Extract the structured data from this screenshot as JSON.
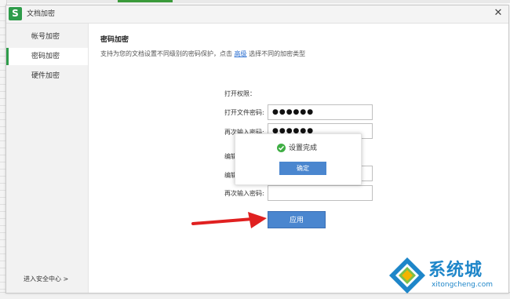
{
  "window": {
    "title": "文档加密"
  },
  "sidebar": {
    "items": [
      {
        "label": "帐号加密"
      },
      {
        "label": "密码加密"
      },
      {
        "label": "硬件加密"
      }
    ],
    "security_center_label": "进入安全中心 >"
  },
  "main": {
    "section_title": "密码加密",
    "description_prefix": "支持为您的文档设置不同级别的密码保护，点击",
    "description_link": "高级",
    "description_suffix": "选择不同的加密类型",
    "open_permission_label": "打开权限：",
    "open_password_label": "打开文件密码:",
    "open_password_value": "●●●●●●",
    "reenter_open_label": "再次输入密码:",
    "reenter_open_value": "●●●●●●",
    "edit_permission_label": "编辑",
    "edit_password_label": "编辑",
    "reenter_edit_label": "再次输入密码:",
    "reenter_edit_value": "",
    "apply_label": "应用"
  },
  "toast": {
    "message": "设置完成",
    "confirm_label": "确定"
  },
  "watermark": {
    "brand_cn": "系统城",
    "brand_en": "xitongcheng.com"
  },
  "colors": {
    "accent_blue": "#4a86cf",
    "success_green": "#3fae44",
    "arrow_red": "#e02020",
    "brand_blue": "#1e86c9"
  }
}
